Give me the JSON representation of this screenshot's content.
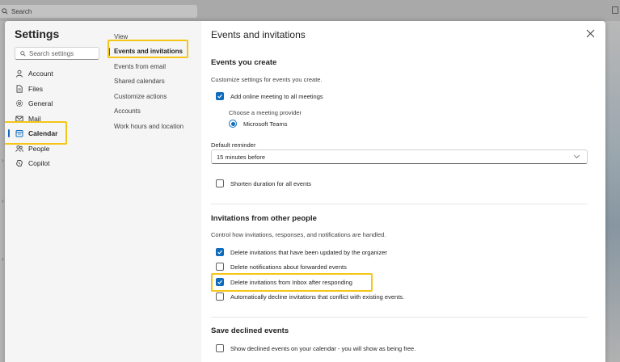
{
  "background": {
    "search_label": "Search"
  },
  "settings": {
    "title": "Settings",
    "search_placeholder": "Search settings",
    "nav": [
      {
        "label": "Account",
        "icon": "person-icon"
      },
      {
        "label": "Files",
        "icon": "file-icon"
      },
      {
        "label": "General",
        "icon": "gear-icon"
      },
      {
        "label": "Mail",
        "icon": "mail-icon"
      },
      {
        "label": "Calendar",
        "icon": "calendar-icon",
        "active": true
      },
      {
        "label": "People",
        "icon": "people-icon"
      },
      {
        "label": "Copilot",
        "icon": "copilot-icon"
      }
    ]
  },
  "subnav": [
    {
      "label": "View"
    },
    {
      "label": "Events and invitations",
      "active": true
    },
    {
      "label": "Events from email"
    },
    {
      "label": "Shared calendars"
    },
    {
      "label": "Customize actions"
    },
    {
      "label": "Accounts"
    },
    {
      "label": "Work hours and location"
    }
  ],
  "pane": {
    "title": "Events and invitations",
    "section_create": {
      "title": "Events you create",
      "description": "Customize settings for events you create.",
      "add_online_meeting": {
        "label": "Add online meeting to all meetings",
        "checked": true
      },
      "provider_label": "Choose a meeting provider",
      "provider_option": {
        "label": "Microsoft Teams",
        "selected": true
      },
      "reminder_label": "Default reminder",
      "reminder_value": "15 minutes before",
      "shorten_duration": {
        "label": "Shorten duration for all events",
        "checked": false
      }
    },
    "section_invitations": {
      "title": "Invitations from other people",
      "description": "Control how invitations, responses, and notifications are handled.",
      "options": [
        {
          "label": "Delete invitations that have been updated by the organizer",
          "checked": true
        },
        {
          "label": "Delete notifications about forwarded events",
          "checked": false
        },
        {
          "label": "Delete invitations from Inbox after responding",
          "checked": true
        },
        {
          "label": "Automatically decline invitations that conflict with existing events.",
          "checked": false
        }
      ]
    },
    "section_declined": {
      "title": "Save declined events",
      "option": {
        "label": "Show declined events on your calendar - you will show as being free.",
        "checked": false
      }
    }
  },
  "colors": {
    "accent": "#0f6cbd",
    "highlight": "#f5c518"
  }
}
